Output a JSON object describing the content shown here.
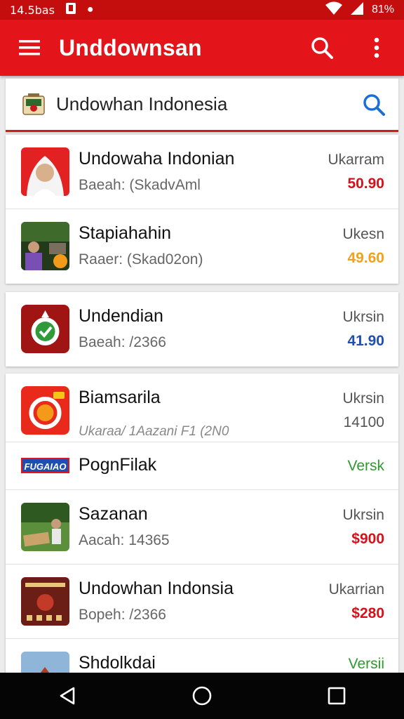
{
  "status_bar": {
    "time": "14.5bas",
    "battery": "81%"
  },
  "app_bar": {
    "title": "Unddownsan"
  },
  "search": {
    "text": "Undowhan Indonesia"
  },
  "items": [
    {
      "title": "Undowaha Indonian",
      "subtitle": "Baeah: (SkadvAml",
      "label": "Ukarram",
      "price": "50.90",
      "price_color": "#d4121b"
    },
    {
      "title": "Stapiahahin",
      "subtitle": "Raaer: (Skad02on)",
      "label": "Ukesn",
      "price": "49.60",
      "price_color": "#f2a11d"
    },
    {
      "title": "Undendian",
      "subtitle": "Baeah: /2366",
      "label": "Ukrsin",
      "price": "41.90",
      "price_color": "#1f4fb0"
    },
    {
      "title": "Biamsarila",
      "subtitle": "Ukaraa/ 1Aazani F1 (2N0",
      "label": "Ukrsin",
      "price": "14100"
    },
    {
      "tag": "FUGAIAO",
      "title": "PognFilak",
      "label": "Versk"
    },
    {
      "title": "Sazanan",
      "subtitle": "Aacah: 14365",
      "label": "Ukrsin",
      "price": "$900",
      "price_color": "#d4121b"
    },
    {
      "title": "Undowhan Indonsia",
      "subtitle": "Bopeh: /2366",
      "label": "Ukarrian",
      "price": "$280",
      "price_color": "#d4121b"
    },
    {
      "title": "Shdolkdai",
      "label": "Versii"
    }
  ]
}
